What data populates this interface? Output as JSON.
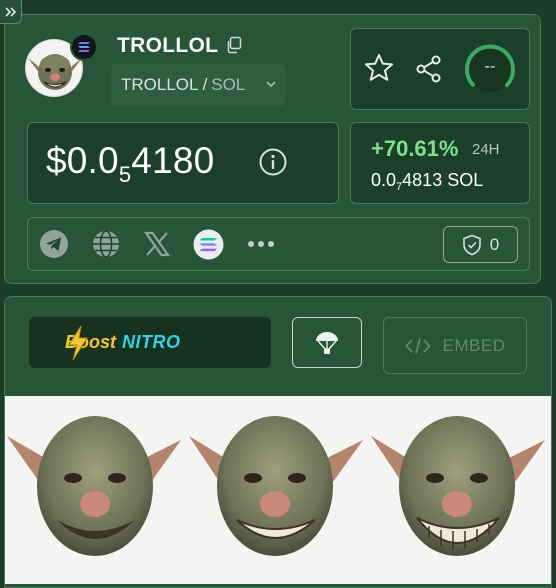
{
  "token": {
    "name": "TROLLOL",
    "pair_base": "TROLLOL /",
    "pair_quote": "SOL"
  },
  "price": {
    "prefix": "$0.0",
    "zeros": "5",
    "digits": "4180"
  },
  "change": {
    "percent": "+70.61%",
    "period": "24H",
    "sol_prefix": "0.0",
    "sol_zeros": "7",
    "sol_digits": "4813 SOL"
  },
  "score": {
    "value": "--"
  },
  "shield": {
    "count": "0"
  },
  "embed": {
    "label": "EMBED"
  },
  "boost": {
    "word1": "Boost",
    "word2": "NITRO"
  },
  "colors": {
    "background": "#1c3d27",
    "card": "#285438",
    "inner": "#1b3f28",
    "positive": "#7ee08c",
    "accent_yellow": "#f3c53a",
    "accent_cyan": "#38d0e6"
  },
  "icons": [
    "expand-icon",
    "solana-icon",
    "copy-icon",
    "chevron-down-icon",
    "star-icon",
    "share-icon",
    "info-icon",
    "telegram-icon",
    "globe-icon",
    "x-icon",
    "solana-icon",
    "more-icon",
    "shield-check-icon",
    "lightning-icon",
    "parachute-icon",
    "code-icon"
  ]
}
